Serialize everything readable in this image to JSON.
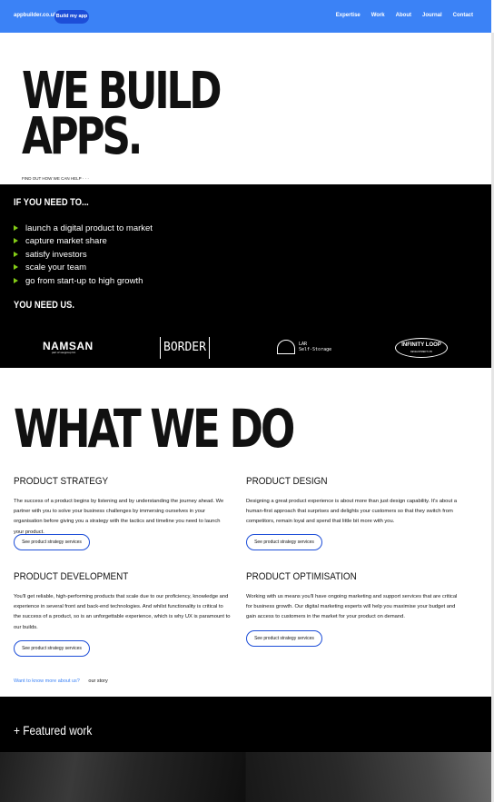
{
  "nav": {
    "logo": "appbuilder.co.uk",
    "cta": "Build my app",
    "links": [
      "Expertise",
      "Work",
      "About",
      "Journal",
      "Contact"
    ]
  },
  "hero": {
    "title_line1": "WE BUILD",
    "title_line2": "APPS.",
    "link": "FIND OUT HOW WE CAN HELP · · ·"
  },
  "need": {
    "heading": "IF YOU NEED TO...",
    "items": [
      "launch a digital product to market",
      "capture market share",
      "satisfy investors",
      "scale your team",
      "go from start-up to high growth"
    ],
    "answer": "YOU NEED US.",
    "bullet_color": "#84cc16"
  },
  "clients": {
    "namsan": "NAMSAN",
    "namsan_sub": "part of ssogroup ltd.",
    "border": "BORDER",
    "lar_line1": "LAR",
    "lar_line2": "Self-Storage",
    "infinity": "INFINITY LOOP",
    "infinity_sub": "DEVELOPMENT LTD"
  },
  "what": {
    "title": "WHAT WE DO",
    "services": [
      {
        "title": "PRODUCT STRATEGY",
        "body": "The success of a product begins by listening and by understanding the journey ahead. We partner with you to solve your business challenges by immersing ourselves in your organisation before giving you a strategy with the tactics and timeline you need to launch your product.",
        "button": "See product strategy services"
      },
      {
        "title": "PRODUCT DESIGN",
        "body": "Designing a great product experience is about more than just design capability. It's about a human-first approach that surprises and delights your customers so that they switch from competitors, remain loyal and spend that little bit more with you.",
        "button": "See product strategy services"
      },
      {
        "title": "PRODUCT DEVELOPMENT",
        "body": "You'll get reliable, high-performing products that scale due to our proficiency, knowledge and experience in several front and back-end technologies. And whilst functionality is critical to the success of a product, so is an unforgettable experience, which is why UX is paramount to our builds.",
        "button": "See product strategy services"
      },
      {
        "title": "PRODUCT OPTIMISATION",
        "body": "Working with us means you'll have ongoing marketing and support services that are critical for business growth. Our digital marketing experts will help you maximise your budget and gain access to customers in the market for your product on demand.",
        "button": "See product strategy services"
      }
    ],
    "more_question": "Want to know more about us?",
    "more_link": "our story"
  },
  "featured": {
    "heading": "+ Featured work"
  },
  "colors": {
    "accent": "#3b82f6",
    "cta": "#1d4ed8",
    "dark": "#000000"
  }
}
